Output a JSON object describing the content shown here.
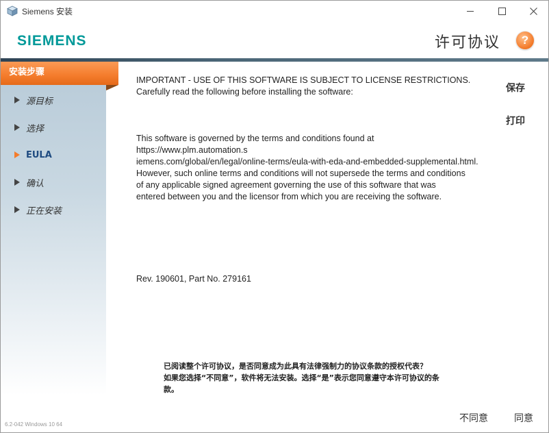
{
  "window": {
    "title": "Siemens 安装",
    "icon": "app-cube-icon"
  },
  "header": {
    "logo": "SIEMENS",
    "page_title": "许可协议",
    "help_symbol": "?"
  },
  "sidebar": {
    "heading": "安装步骤",
    "steps": [
      {
        "label": "源目标",
        "active": false
      },
      {
        "label": "选择",
        "active": false
      },
      {
        "label": "EULA",
        "active": true
      },
      {
        "label": "确认",
        "active": false
      },
      {
        "label": "正在安装",
        "active": false
      }
    ],
    "version": "6.2-042   Windows 10 64"
  },
  "content": {
    "p1": "IMPORTANT - USE OF THIS SOFTWARE IS SUBJECT TO LICENSE RESTRICTIONS.\nCarefully read the following before installing the software:",
    "p2": "This software is governed by the terms and conditions found at https://www.plm.automation.s\niemens.com/global/en/legal/online-terms/eula-with-eda-and-embedded-supplemental.html.\nHowever, such online terms and conditions will not supersede the terms and conditions\nof any applicable signed agreement governing the use of this software that was\nentered between you and the licensor from which you are receiving the software.",
    "p3": "Rev. 190601, Part No. 279161"
  },
  "actions": {
    "save": "保存",
    "print": "打印"
  },
  "footer": {
    "question": "已阅读整个许可协议，是否同意成为此具有法律强制力的协议条款的授权代表？\n如果您选择“不同意”，软件将无法安装。选择“是”表示您同意遵守本许可协议的条\n款。",
    "disagree": "不同意",
    "agree": "同意"
  },
  "colors": {
    "brand": "#009999",
    "accent": "#f47c2c",
    "active_step": "#1e4a80"
  }
}
